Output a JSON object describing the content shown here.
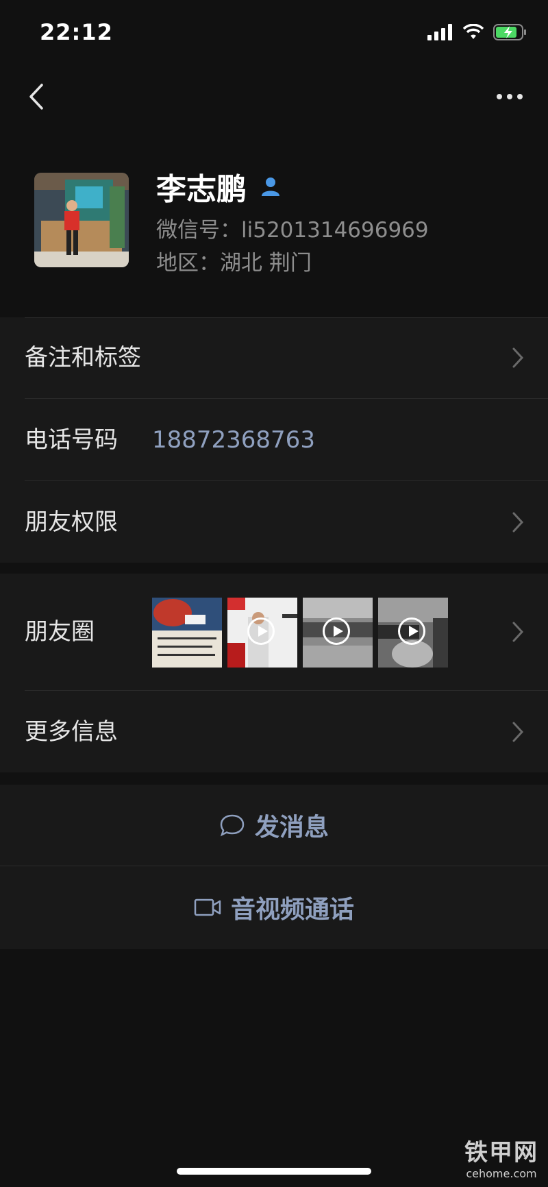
{
  "status_bar": {
    "time": "22:12"
  },
  "profile": {
    "name": "李志鹏",
    "wechat_id": "微信号：li5201314696969",
    "region": "地区：湖北 荆门"
  },
  "rows": {
    "remarks_tags": "备注和标签",
    "phone_label": "电话号码",
    "phone_value": "18872368763",
    "friend_permissions": "朋友权限",
    "moments": "朋友圈",
    "more_info": "更多信息"
  },
  "actions": {
    "send_message": "发消息",
    "av_call": "音视频通话"
  },
  "watermark": {
    "brand": "铁甲网",
    "domain": "cehome.com"
  },
  "colors": {
    "background": "#111111",
    "card": "#191919",
    "link": "#8fa0bf"
  }
}
